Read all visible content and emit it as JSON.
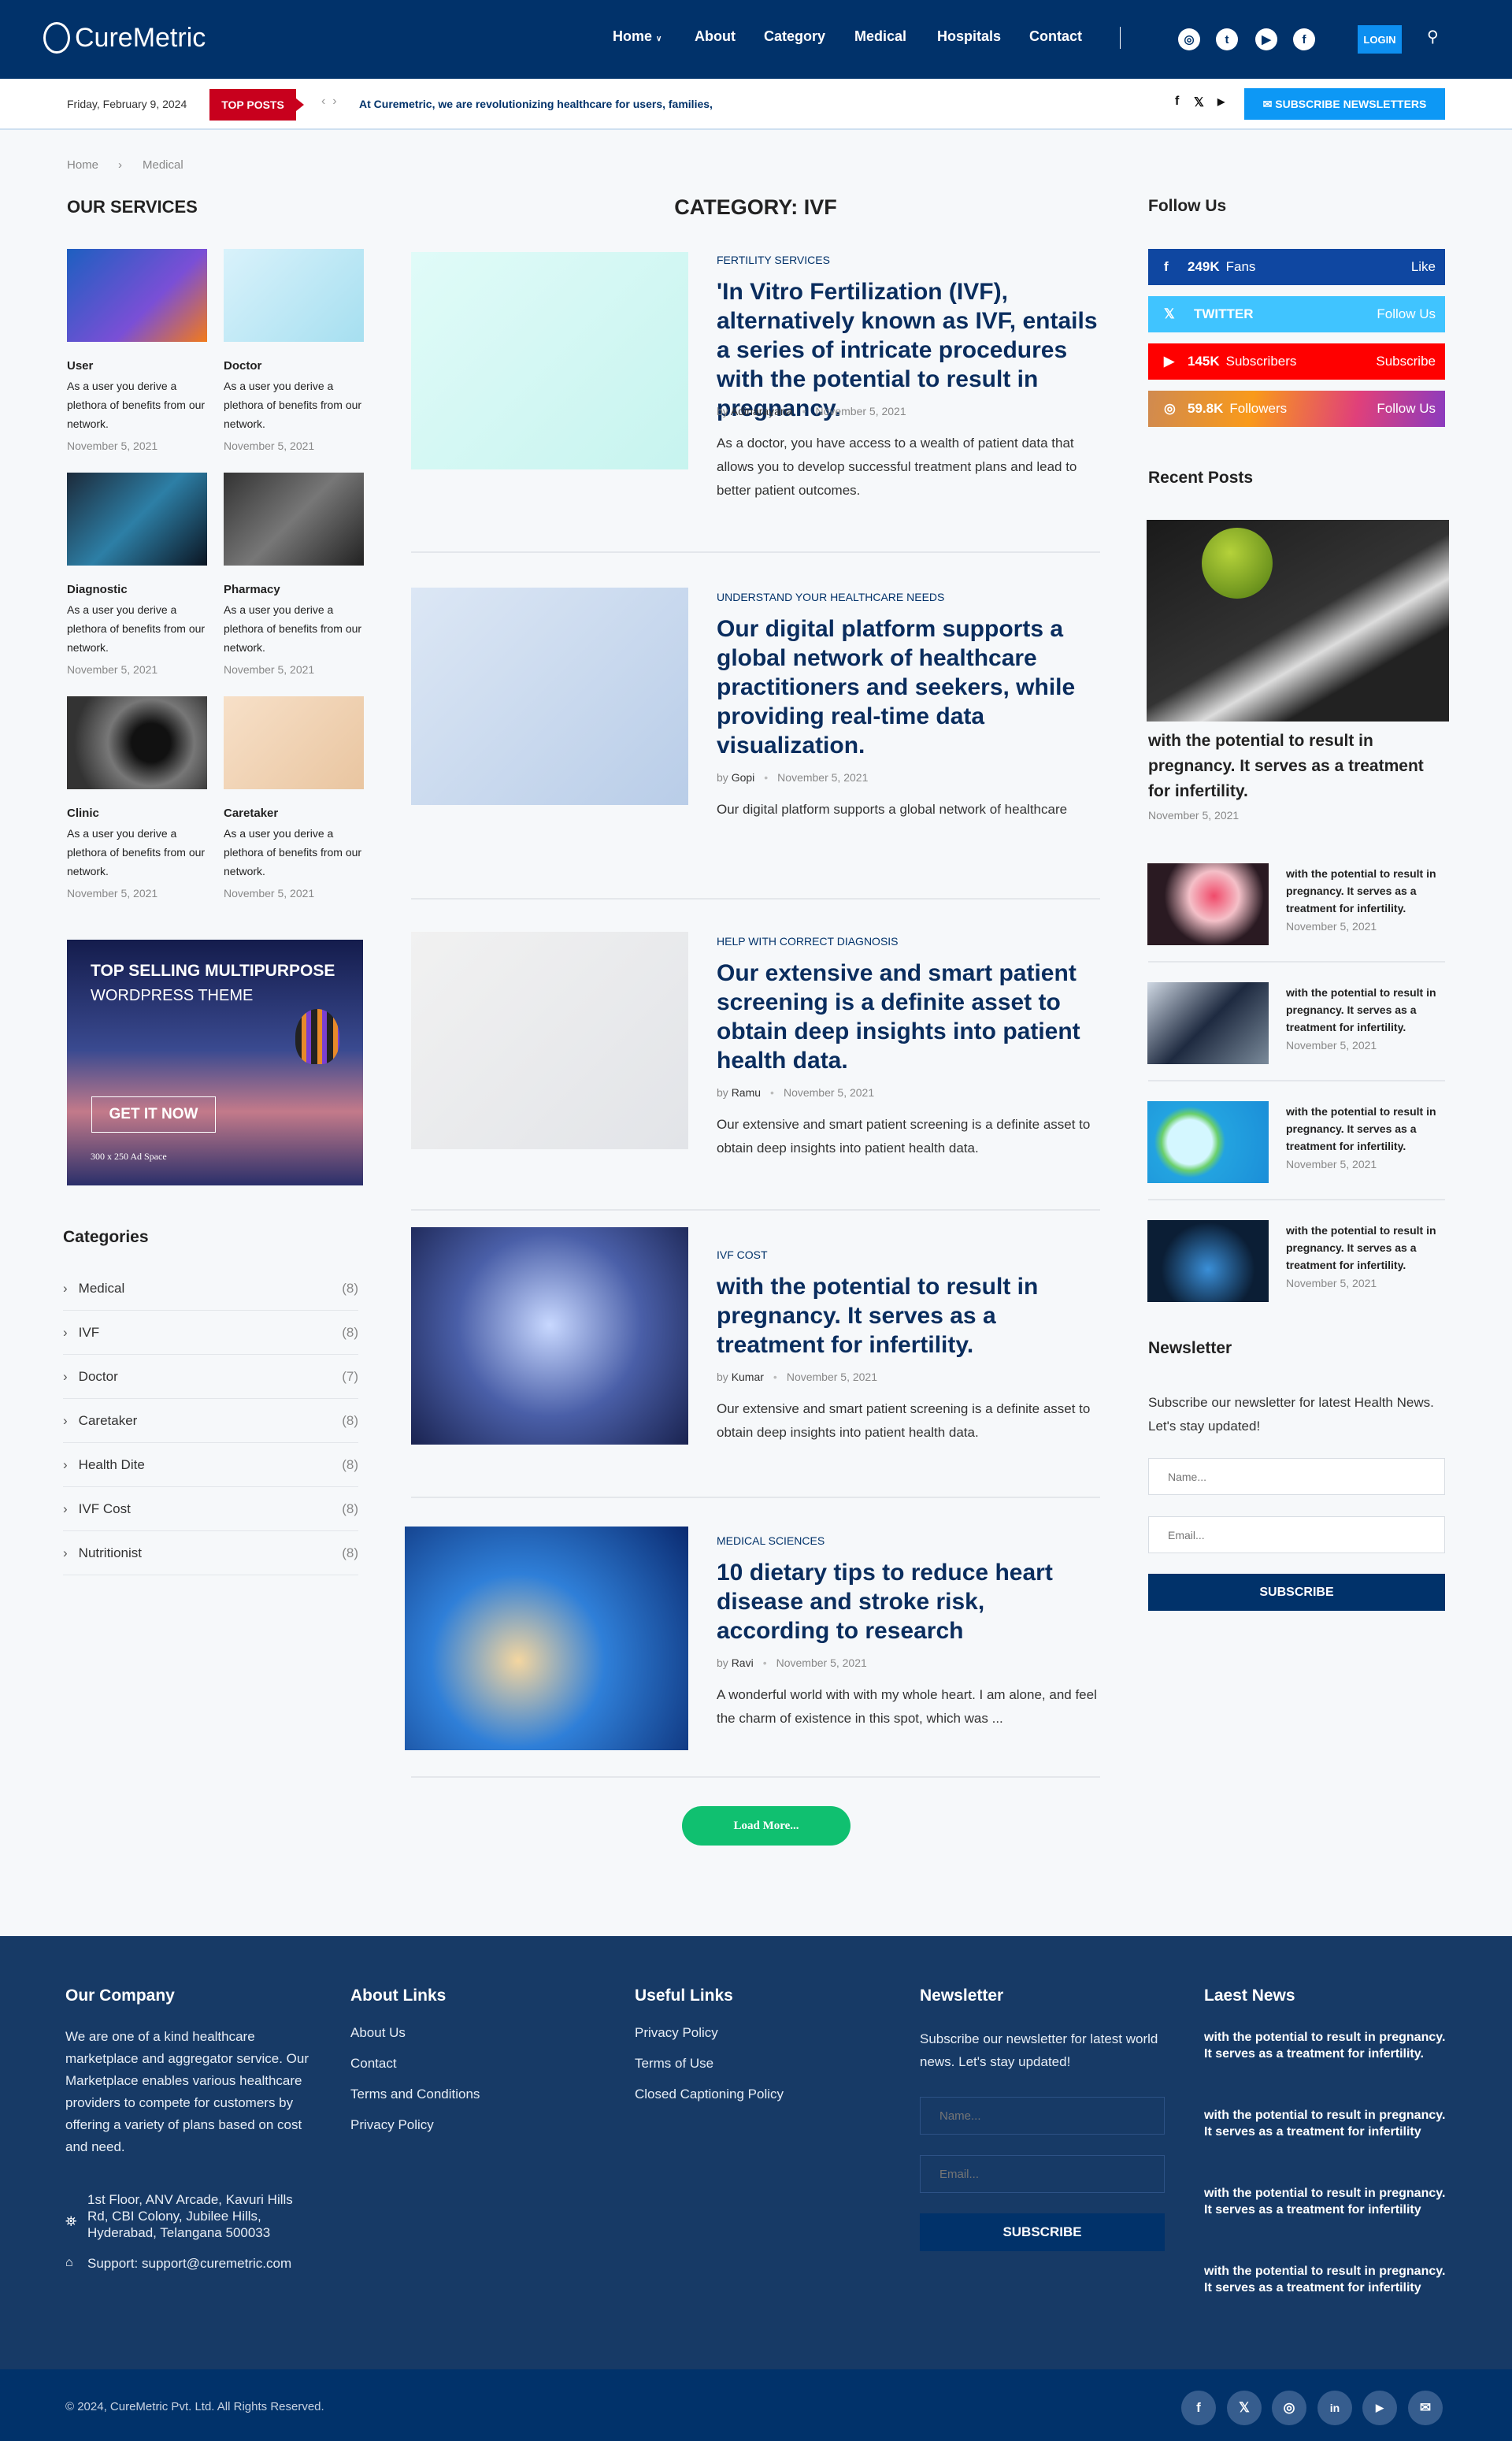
{
  "header": {
    "brand": "CureMetric",
    "nav": [
      "Home",
      "About",
      "Category",
      "Medical",
      "Hospitals",
      "Contact"
    ],
    "login": "LOGIN"
  },
  "topbar": {
    "date": "Friday, February 9, 2024",
    "top_posts": "TOP POSTS",
    "ticker": "At Curemetric, we are revolutionizing healthcare for users, families,",
    "subscribe": "SUBSCRIBE NEWSLETTERS"
  },
  "breadcrumb": [
    "Home",
    "Medical"
  ],
  "services": {
    "title": "OUR SERVICES",
    "items": [
      {
        "title": "User",
        "desc": "As a user you derive a plethora of benefits from our network.",
        "date": "November 5, 2021"
      },
      {
        "title": "Doctor",
        "desc": "As a user you derive a plethora of benefits from our network.",
        "date": "November 5, 2021"
      },
      {
        "title": "Diagnostic",
        "desc": "As a user you derive a plethora of benefits from our network.",
        "date": "November 5, 2021"
      },
      {
        "title": "Pharmacy",
        "desc": "As a user you derive a plethora of benefits from our network.",
        "date": "November 5, 2021"
      },
      {
        "title": "Clinic",
        "desc": "As a user you derive a plethora of benefits from our network.",
        "date": "November 5, 2021"
      },
      {
        "title": "Caretaker",
        "desc": "As a user you derive a plethora of benefits from our network.",
        "date": "November 5, 2021"
      }
    ]
  },
  "ad": {
    "line1": "TOP SELLING MULTIPURPOSE",
    "line2": "WORDPRESS THEME",
    "cta": "GET IT NOW",
    "size": "300 x 250 Ad Space"
  },
  "categories": {
    "title": "Categories",
    "items": [
      {
        "name": "Medical",
        "count": "(8)"
      },
      {
        "name": "IVF",
        "count": "(8)"
      },
      {
        "name": "Doctor",
        "count": "(7)"
      },
      {
        "name": "Caretaker",
        "count": "(8)"
      },
      {
        "name": "Health Dite",
        "count": "(8)"
      },
      {
        "name": "IVF Cost",
        "count": "(8)"
      },
      {
        "name": "Nutritionist",
        "count": "(8)"
      }
    ]
  },
  "main": {
    "title": "CATEGORY: IVF",
    "load_more": "Load More...",
    "articles": [
      {
        "cat": "FERTILITY SERVICES",
        "title": "'In Vitro Fertilization (IVF), alternatively known as IVF, entails a series of intricate procedures with the potential to result in pregnancy.",
        "by": "by",
        "author": "Adinarayana",
        "date": "November 5, 2021",
        "excerpt": "As a doctor, you have access to a wealth of patient data that allows you to develop successful treatment plans and lead to better patient outcomes."
      },
      {
        "cat": "UNDERSTAND YOUR HEALTHCARE NEEDS",
        "title": "Our digital platform supports a global network of healthcare practitioners and seekers, while providing real-time data visualization.",
        "by": "by",
        "author": "Gopi",
        "date": "November 5, 2021",
        "excerpt": "Our digital platform supports a global network of healthcare"
      },
      {
        "cat": "HELP WITH CORRECT DIAGNOSIS",
        "title": "Our extensive and smart patient screening is a definite asset to obtain deep insights into patient health data.",
        "by": "by",
        "author": "Ramu",
        "date": "November 5, 2021",
        "excerpt": "Our extensive and smart patient screening is a definite asset to obtain deep insights into patient health data."
      },
      {
        "cat": "IVF COST",
        "title": "with the potential to result in pregnancy. It serves as a treatment for infertility.",
        "by": "by",
        "author": "Kumar",
        "date": "November 5, 2021",
        "excerpt": "Our extensive and smart patient screening is a definite asset to obtain deep insights into patient health data."
      },
      {
        "cat": "MEDICAL SCIENCES",
        "title": "10 dietary tips to reduce heart disease and stroke risk, according to research",
        "by": "by",
        "author": "Ravi",
        "date": "November 5, 2021",
        "excerpt": "A wonderful world with with my whole heart. I am alone, and feel the charm of existence in this spot, which was ..."
      }
    ]
  },
  "follow": {
    "title": "Follow Us",
    "items": [
      {
        "count": "249K",
        "label": "Fans",
        "action": "Like",
        "color": "#0f47a1"
      },
      {
        "count": "",
        "label": "TWITTER",
        "action": "Follow Us",
        "color": "#40c4ff"
      },
      {
        "count": "145K",
        "label": "Subscribers",
        "action": "Subscribe",
        "color": "#ff0000"
      },
      {
        "count": "59.8K",
        "label": "Followers",
        "action": "Follow Us",
        "color": "#e4405f"
      }
    ]
  },
  "recent": {
    "title": "Recent Posts",
    "featured": {
      "title": "with the potential to result in pregnancy. It serves as a treatment for infertility.",
      "date": "November 5, 2021"
    },
    "items": [
      {
        "title": "with the potential to result in pregnancy. It serves as a treatment for infertility.",
        "date": "November 5, 2021"
      },
      {
        "title": "with the potential to result in pregnancy. It serves as a treatment for infertility.",
        "date": "November 5, 2021"
      },
      {
        "title": "with the potential to result in pregnancy. It serves as a treatment for infertility.",
        "date": "November 5, 2021"
      },
      {
        "title": "with the potential to result in pregnancy. It serves as a treatment for infertility.",
        "date": "November 5, 2021"
      }
    ]
  },
  "newsletter": {
    "title": "Newsletter",
    "text": "Subscribe our newsletter for latest Health News. Let's stay updated!",
    "name_ph": "Name...",
    "email_ph": "Email...",
    "button": "SUBSCRIBE"
  },
  "footer": {
    "company": {
      "title": "Our Company",
      "text": "We are one of a kind healthcare marketplace and aggregator service. Our Marketplace enables various healthcare providers to compete for customers by offering a variety of plans based on cost and need.",
      "address": "1st Floor, ANV Arcade, Kavuri Hills Rd, CBI Colony, Jubilee Hills, Hyderabad, Telangana 500033",
      "support": "Support: support@curemetric.com"
    },
    "about": {
      "title": "About Links",
      "links": [
        "About Us",
        "Contact",
        "Terms and Conditions",
        "Privacy Policy"
      ]
    },
    "useful": {
      "title": "Useful Links",
      "links": [
        "Privacy Policy",
        "Terms of Use",
        "Closed Captioning Policy"
      ]
    },
    "newsletter": {
      "title": "Newsletter",
      "text": "Subscribe our newsletter for latest world news. Let's stay updated!",
      "name_ph": "Name...",
      "email_ph": "Email...",
      "button": "SUBSCRIBE"
    },
    "news": {
      "title": "Laest News",
      "items": [
        "with the potential to result in pregnancy. It serves as a treatment for infertility.",
        "with the potential to result in pregnancy. It serves as a treatment for infertility",
        "with the potential to result in pregnancy. It serves as a treatment for infertility",
        "with the potential to result in pregnancy. It serves as a treatment for infertility"
      ]
    },
    "copyright": "© 2024, CureMetric Pvt. Ltd. All Rights Reserved."
  }
}
